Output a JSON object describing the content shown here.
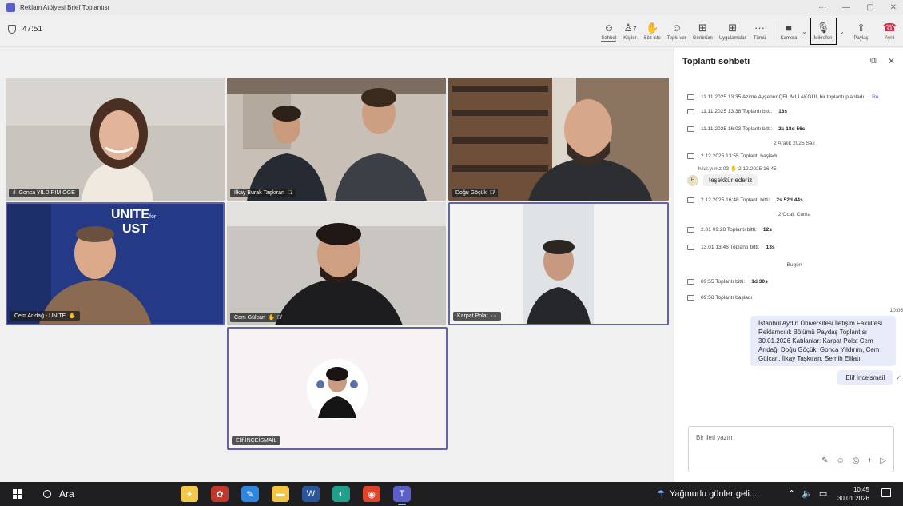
{
  "window": {
    "title": "Reklam Atölyesi Brief Toplantısı",
    "controls": [
      "···",
      "—",
      "▢",
      "✕"
    ]
  },
  "meeting": {
    "timer": "47:51"
  },
  "toolbar": [
    {
      "id": "chat",
      "icon": "☺",
      "label": "Sohbet",
      "active": true
    },
    {
      "id": "people",
      "icon": "♙",
      "label": "Kişiler",
      "count": "7"
    },
    {
      "id": "raise",
      "icon": "✋",
      "label": "Söz iste"
    },
    {
      "id": "react",
      "icon": "☺",
      "label": "Tepki ver"
    },
    {
      "id": "view",
      "icon": "⊞",
      "label": "Görünüm"
    },
    {
      "id": "apps",
      "icon": "⊞",
      "label": "Uygulamalar"
    },
    {
      "id": "more",
      "icon": "···",
      "label": "Tümü"
    },
    {
      "id": "camera",
      "icon": "■",
      "label": "Kamera"
    },
    {
      "id": "mic",
      "icon": "🎙",
      "label": "Mikrofon"
    },
    {
      "id": "share",
      "icon": "⇧",
      "label": "Paylaş"
    },
    {
      "id": "leave",
      "icon": "☎",
      "label": "Ayrıl"
    }
  ],
  "participants": [
    {
      "name": "Gonca YILDIRIM ÖGE",
      "bg": "#b8b1a8",
      "prefix": "ıl"
    },
    {
      "name": "İlkay Burak Taşkıran",
      "bg": "#8c7d6e",
      "suffix": "🎙̸"
    },
    {
      "name": "Doğu Göçük",
      "bg": "#9a7f66",
      "suffix": "🎙̸"
    },
    {
      "name": "Cem Arıdağ - UNITE",
      "bg": "#2a3f86",
      "suffix": "✋"
    },
    {
      "name": "Cem Gülcan",
      "bg": "#b9b5af",
      "suffix": "✋ 🎙̸"
    },
    {
      "name": "Karpat Polat",
      "bg": "#e6e8ea",
      "suffix": "···"
    },
    {
      "name": "Elif İNCEİSMAİL",
      "bg": "#f7f3f4"
    }
  ],
  "cem_screen_text": {
    "line1": "UNITE",
    "for": "for",
    "line2": "UST"
  },
  "chat": {
    "title": "Toplantı sohbeti",
    "feed": [
      {
        "kind": "event",
        "text": "11.11.2025 13:35   Azime Ayşenur ÇELİMLİ AKGÜL bir toplantı planladı.",
        "extra": "Re"
      },
      {
        "kind": "event",
        "text": "11.11.2025 13:38   Toplantı bitti: ",
        "bold": "13s"
      },
      {
        "kind": "event",
        "text": "11.11.2025 16:03   Toplantı bitti: ",
        "bold": "2s 18d 56s"
      },
      {
        "kind": "day",
        "text": "2 Aralık 2025 Salı"
      },
      {
        "kind": "event",
        "text": "2.12.2025 13:55   Toplantı başladı"
      },
      {
        "kind": "meta",
        "text": "hilal.yılmz.03  ✋  2.12.2025 16:45"
      },
      {
        "kind": "message",
        "avatar": "H",
        "text": "teşekkür ederiz"
      },
      {
        "kind": "event",
        "text": "2.12.2025 16:48   Toplantı bitti: ",
        "bold": "2s 52d 44s"
      },
      {
        "kind": "day",
        "text": "2 Ocak Cuma"
      },
      {
        "kind": "event",
        "text": "2.01 09:28   Toplantı bitti: ",
        "bold": "12s"
      },
      {
        "kind": "event",
        "text": "13.01 13:46   Toplantı bitti: ",
        "bold": "13s"
      },
      {
        "kind": "day",
        "text": "Bugün"
      },
      {
        "kind": "event",
        "text": "09:55   Toplantı bitti: ",
        "bold": "1d 30s"
      },
      {
        "kind": "event",
        "text": "09:58   Toplantı başladı"
      }
    ],
    "outgoing_time": "10:06",
    "outgoing": [
      "İstanbul Aydın Üniversitesi İletişim Fakültesi Reklamcılık Bölümü Paydaş Toplantısı 30.01.2026  Katılanlar: Karpat Polat Cem Arıdağ, Doğu Göçük, Gonca Yıldırım, Cem Gülcan, İlkay Taşkıran, Semih Elilatı.",
      "Elif İnceismail"
    ],
    "compose_placeholder": "Bir ileti yazın",
    "compose_icons": [
      "✎",
      "☺",
      "◎",
      "+",
      "▷"
    ]
  },
  "taskbar": {
    "search": "Ara",
    "weather": "Yağmurlu günler geli...",
    "time": "10:45",
    "date": "30.01.2026",
    "apps": [
      {
        "name": "copilot",
        "glyph": "✦",
        "color": "#f2c94c"
      },
      {
        "name": "app-1",
        "glyph": "✿",
        "color": "#c0392b"
      },
      {
        "name": "app-2",
        "glyph": "✎",
        "color": "#2e86de"
      },
      {
        "name": "explorer",
        "glyph": "▬",
        "color": "#f4c542"
      },
      {
        "name": "word",
        "glyph": "W",
        "color": "#2b579a"
      },
      {
        "name": "edge",
        "glyph": "◐",
        "color": "#1fa08d"
      },
      {
        "name": "chrome",
        "glyph": "◉",
        "color": "#e0452c"
      },
      {
        "name": "teams",
        "glyph": "T",
        "color": "#5b5fc7"
      }
    ]
  }
}
